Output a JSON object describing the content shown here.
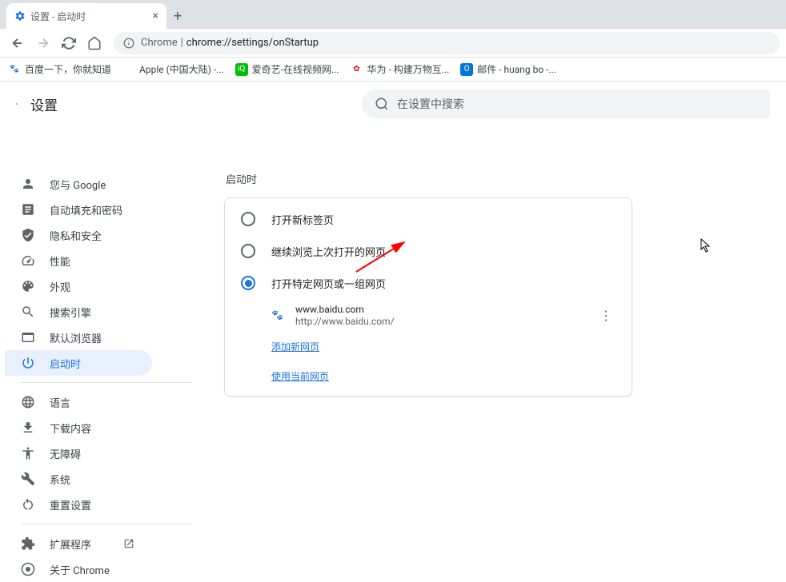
{
  "browser": {
    "tab_title": "设置 - 启动时",
    "address_prefix": "Chrome",
    "address_separator": " | ",
    "address_url": "chrome://settings/onStartup"
  },
  "bookmarks": [
    {
      "label": "百度一下，你就知道",
      "color": "#2932e1",
      "icon": "paw"
    },
    {
      "label": "Apple (中国大陆) -...",
      "color": "#999",
      "icon": "apple"
    },
    {
      "label": "爱奇艺-在线视频网...",
      "color": "#00be06",
      "icon": "iqiyi"
    },
    {
      "label": "华为 - 构建万物互...",
      "color": "#e60012",
      "icon": "huawei"
    },
    {
      "label": "邮件 - huang bo -...",
      "color": "#0078d4",
      "icon": "outlook"
    }
  ],
  "settings": {
    "title": "设置",
    "search_placeholder": "在设置中搜索"
  },
  "sidebar": {
    "items": [
      {
        "label": "您与 Google",
        "icon": "person"
      },
      {
        "label": "自动填充和密码",
        "icon": "autofill"
      },
      {
        "label": "隐私和安全",
        "icon": "shield"
      },
      {
        "label": "性能",
        "icon": "speed"
      },
      {
        "label": "外观",
        "icon": "palette"
      },
      {
        "label": "搜索引擎",
        "icon": "search"
      },
      {
        "label": "默认浏览器",
        "icon": "browser"
      },
      {
        "label": "启动时",
        "icon": "power",
        "active": true
      }
    ],
    "items2": [
      {
        "label": "语言",
        "icon": "globe"
      },
      {
        "label": "下载内容",
        "icon": "download"
      },
      {
        "label": "无障碍",
        "icon": "accessibility"
      },
      {
        "label": "系统",
        "icon": "wrench"
      },
      {
        "label": "重置设置",
        "icon": "reset"
      }
    ],
    "items3": [
      {
        "label": "扩展程序",
        "icon": "extension",
        "external": true
      },
      {
        "label": "关于 Chrome",
        "icon": "chrome"
      }
    ]
  },
  "startup": {
    "section_title": "启动时",
    "options": [
      {
        "label": "打开新标签页",
        "checked": false
      },
      {
        "label": "继续浏览上次打开的网页",
        "checked": false
      },
      {
        "label": "打开特定网页或一组网页",
        "checked": true
      }
    ],
    "pages": [
      {
        "name": "www.baidu.com",
        "url": "http://www.baidu.com/"
      }
    ],
    "add_link": "添加新网页",
    "use_current_link": "使用当前网页"
  }
}
